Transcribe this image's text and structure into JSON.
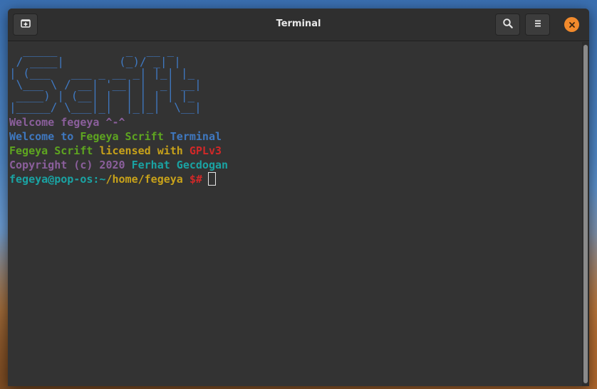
{
  "window": {
    "title": "Terminal"
  },
  "header": {
    "new_tab_icon": "new-tab-icon",
    "search_icon": "search-icon",
    "menu_icon": "hamburger-menu-icon",
    "close_icon": "close-icon",
    "close_color": "#f28a2c"
  },
  "terminal": {
    "ascii_art": [
      "  _____          _  __ _   ",
      " / ____|        (_)/ _| |  ",
      "| (___   ___ _ __ _| |_| |_ ",
      " \\___ \\ / __| '__| |  _| __|",
      " ____) | (__| |  | | | | |_ ",
      "|_____/ \\___|_|  |_|_|  \\__|"
    ],
    "welcome_user": "Welcome fegeya ^-^",
    "welcome_to": "Welcome to",
    "product": "Fegeya Scrift",
    "terminal_word": "Terminal",
    "license_product": "Fegeya Scrift",
    "license_text": "licensed with",
    "license_name": "GPLv3",
    "copyright": "Copyright (c) 2020",
    "author": "Ferhat Gecdogan",
    "prompt_user": "fegeya@pop-os:~",
    "prompt_path": "/home/fegeya",
    "prompt_symbol": "$#"
  },
  "colors": {
    "purple": "#8b5f9c",
    "blue": "#3f78c0",
    "green": "#5ea520",
    "yellow": "#c8a21a",
    "red": "#d12828",
    "cyan": "#1aa3a3"
  }
}
